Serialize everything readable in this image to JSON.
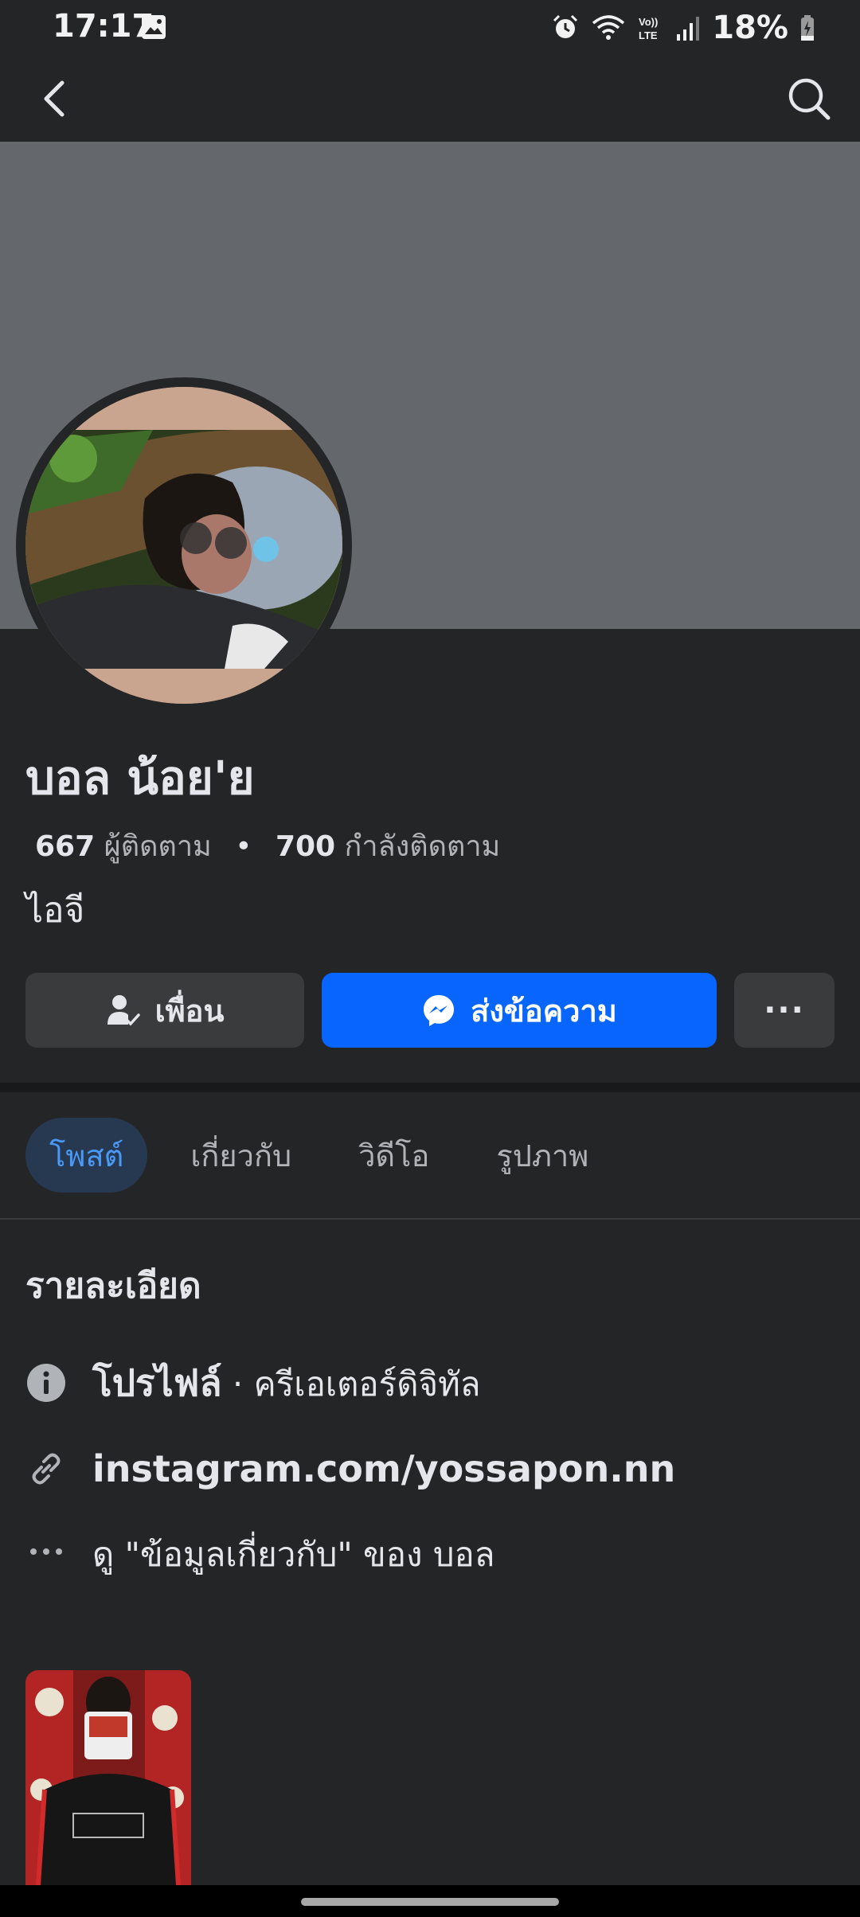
{
  "status_bar": {
    "time": "17:17",
    "battery": "18%",
    "icons": [
      "image-icon",
      "alarm-icon",
      "wifi-icon",
      "volte-icon",
      "signal-icon",
      "battery-charging-icon"
    ]
  },
  "nav": {
    "back_icon": "back-chevron-icon",
    "search_icon": "search-icon"
  },
  "profile": {
    "name": "บอล น้อย'ย",
    "followers_count": "667",
    "followers_label": "ผู้ติดตาม",
    "separator": "•",
    "following_count": "700",
    "following_label": "กำลังติดตาม",
    "bio": "ไอจี"
  },
  "actions": {
    "friends_label": "เพื่อน",
    "message_label": "ส่งข้อความ",
    "more_label": "···"
  },
  "tabs": [
    {
      "label": "โพสต์",
      "active": true
    },
    {
      "label": "เกี่ยวกับ",
      "active": false
    },
    {
      "label": "วิดีโอ",
      "active": false
    },
    {
      "label": "รูปภาพ",
      "active": false
    }
  ],
  "details": {
    "title": "รายละเอียด",
    "profile_label": "โปรไฟล์",
    "profile_category": " · ครีเอเตอร์ดิจิทัล",
    "link": "instagram.com/yossapon.nn",
    "see_about": "ดู \"ข้อมูลเกี่ยวกับ\" ของ บอล"
  },
  "colors": {
    "background": "#242527",
    "cover": "#64676c",
    "primary": "#0866ff",
    "tab_active_bg": "#263951",
    "tab_active_text": "#4a99f6"
  }
}
